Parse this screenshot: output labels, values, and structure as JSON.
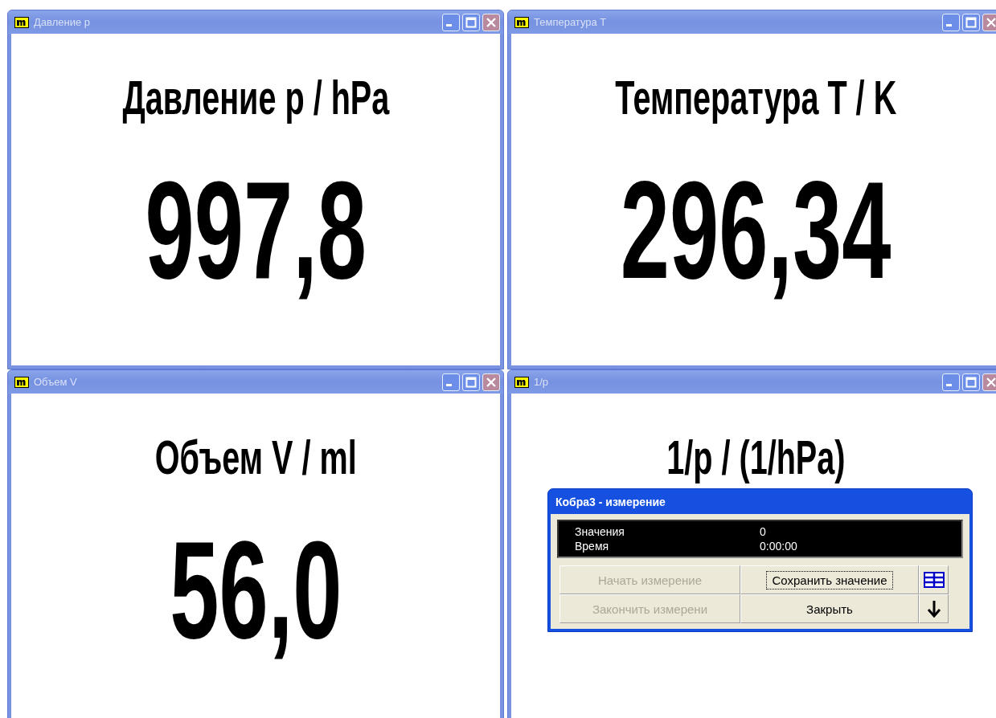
{
  "windows": [
    {
      "title": "Давление p",
      "heading": "Давление p / hPa",
      "value": "997,8"
    },
    {
      "title": "Температура T",
      "heading": "Температура T / K",
      "value": "296,34"
    },
    {
      "title": "Объем V",
      "heading": "Объем V / ml",
      "value": "56,0"
    },
    {
      "title": "1/p",
      "heading": "1/p / (1/hPa)"
    }
  ],
  "dialog": {
    "title": "Кобра3 - измерение",
    "readouts": [
      {
        "label": "Значения",
        "value": "0"
      },
      {
        "label": "Время",
        "value": "0:00:00"
      }
    ],
    "buttons": [
      {
        "kind": "text",
        "label": "Начать измерение",
        "disabled": true,
        "focused": false
      },
      {
        "kind": "text",
        "label": "Сохранить значение",
        "disabled": false,
        "focused": true
      },
      {
        "kind": "table"
      },
      {
        "kind": "text",
        "label": "Закончить измерени",
        "disabled": true,
        "focused": false
      },
      {
        "kind": "text",
        "label": "Закрыть",
        "disabled": false,
        "focused": false
      },
      {
        "kind": "arrow"
      }
    ]
  }
}
